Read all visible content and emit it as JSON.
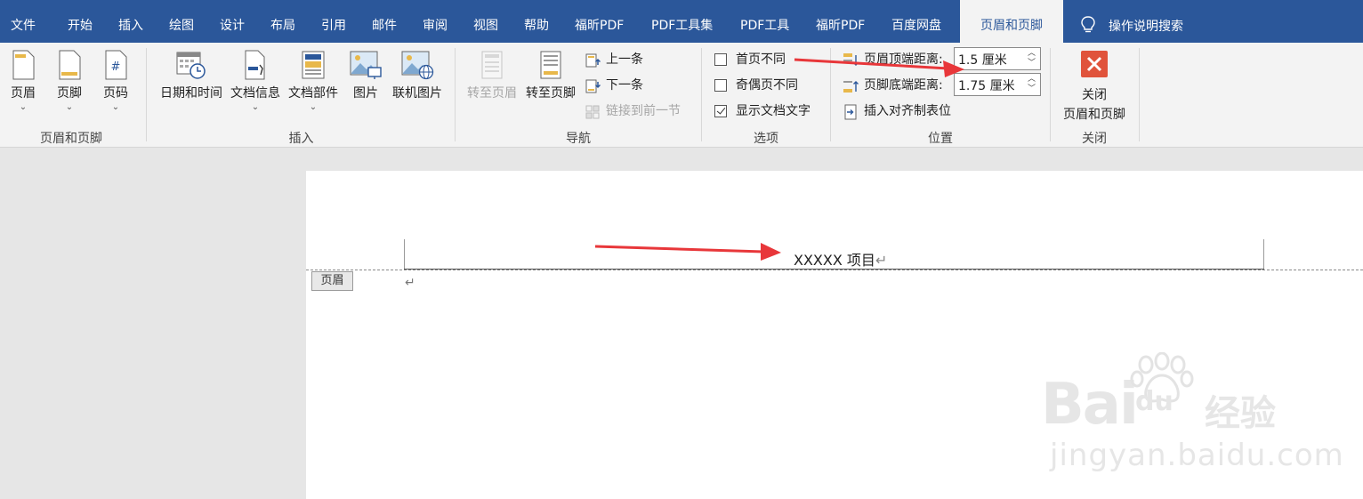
{
  "tabs": [
    "文件",
    "开始",
    "插入",
    "绘图",
    "设计",
    "布局",
    "引用",
    "邮件",
    "审阅",
    "视图",
    "帮助",
    "福昕PDF",
    "PDF工具集",
    "PDF工具",
    "福昕PDF",
    "百度网盘",
    "页眉和页脚"
  ],
  "tell_me": "操作说明搜索",
  "groups": {
    "header_footer": {
      "label": "页眉和页脚",
      "header": "页眉",
      "footer": "页脚",
      "page_number": "页码"
    },
    "insert": {
      "label": "插入",
      "date_time": "日期和时间",
      "doc_info": "文档信息",
      "doc_parts": "文档部件",
      "picture": "图片",
      "online_picture": "联机图片"
    },
    "navigation": {
      "label": "导航",
      "go_to_header": "转至页眉",
      "go_to_footer": "转至页脚",
      "previous": "上一条",
      "next": "下一条",
      "link_previous": "链接到前一节"
    },
    "options": {
      "label": "选项",
      "different_first_page": "首页不同",
      "different_odd_even": "奇偶页不同",
      "show_document_text": "显示文档文字",
      "different_first_page_checked": false,
      "different_odd_even_checked": false,
      "show_document_text_checked": true
    },
    "position": {
      "label": "位置",
      "header_from_top_label": "页眉顶端距离:",
      "header_from_top_value": "1.5 厘米",
      "footer_from_bottom_label": "页脚底端距离:",
      "footer_from_bottom_value": "1.75 厘米",
      "insert_alignment_tab": "插入对齐制表位"
    },
    "close": {
      "label": "关闭",
      "close_line1": "关闭",
      "close_line2": "页眉和页脚"
    }
  },
  "document": {
    "header_text": "XXXXX 项目",
    "header_tag": "页眉",
    "return_mark": "↵"
  },
  "watermark": {
    "brand": "Bai",
    "brand2": "du",
    "suffix": "经验",
    "url": "jingyan.baidu.com"
  },
  "colors": {
    "tab_bar": "#2b579a",
    "ribbon": "#f3f3f3",
    "close_red": "#e0533b",
    "arrow_red": "#e8373a"
  }
}
